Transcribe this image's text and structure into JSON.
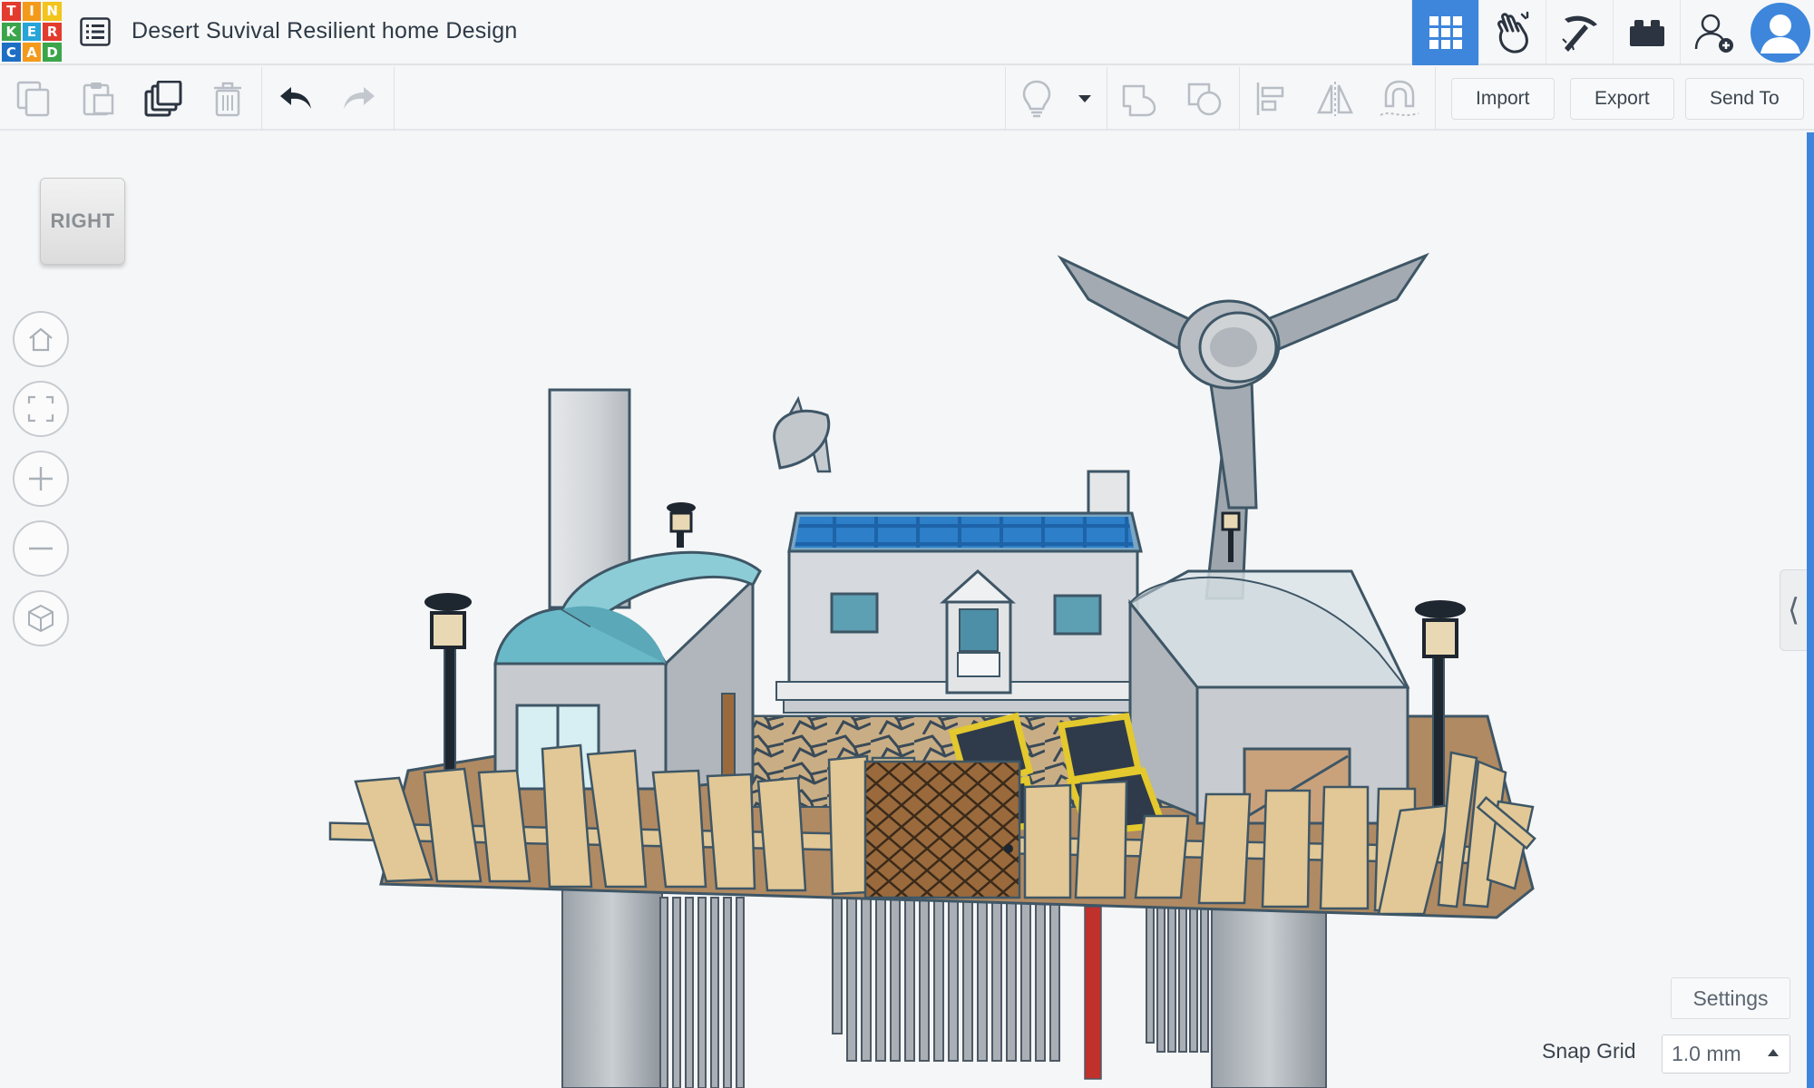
{
  "app": {
    "logo_letters": [
      "T",
      "I",
      "N",
      "K",
      "E",
      "R",
      "C",
      "A",
      "D"
    ],
    "logo_colors": [
      "#e33b2e",
      "#f39a1b",
      "#f3c41b",
      "#3aa54a",
      "#27a4d8",
      "#e33b2e",
      "#1d6fc4",
      "#f39a1b",
      "#3aa54a"
    ],
    "design_title": "Desert Suvival Resilient home Design"
  },
  "top_nav": {
    "items": [
      {
        "name": "3d-design-view-icon",
        "active": true
      },
      {
        "name": "codeblocks-icon",
        "active": false
      },
      {
        "name": "sim-lab-pickaxe-icon",
        "active": false
      },
      {
        "name": "bricks-icon",
        "active": false
      },
      {
        "name": "invite-user-icon",
        "active": false
      },
      {
        "name": "user-avatar-icon",
        "active": false
      }
    ],
    "accent_color": "#3d86dc"
  },
  "toolbar": {
    "import_label": "Import",
    "export_label": "Export",
    "send_to_label": "Send To"
  },
  "viewport": {
    "view_cube_label": "RIGHT",
    "nav_buttons": [
      "home-view-icon",
      "fit-view-icon",
      "zoom-in-icon",
      "zoom-out-icon",
      "perspective-icon"
    ],
    "settings_label": "Settings",
    "snap_grid_label": "Snap Grid",
    "snap_grid_value": "1.0 mm",
    "collapse_glyph": "⟨"
  }
}
